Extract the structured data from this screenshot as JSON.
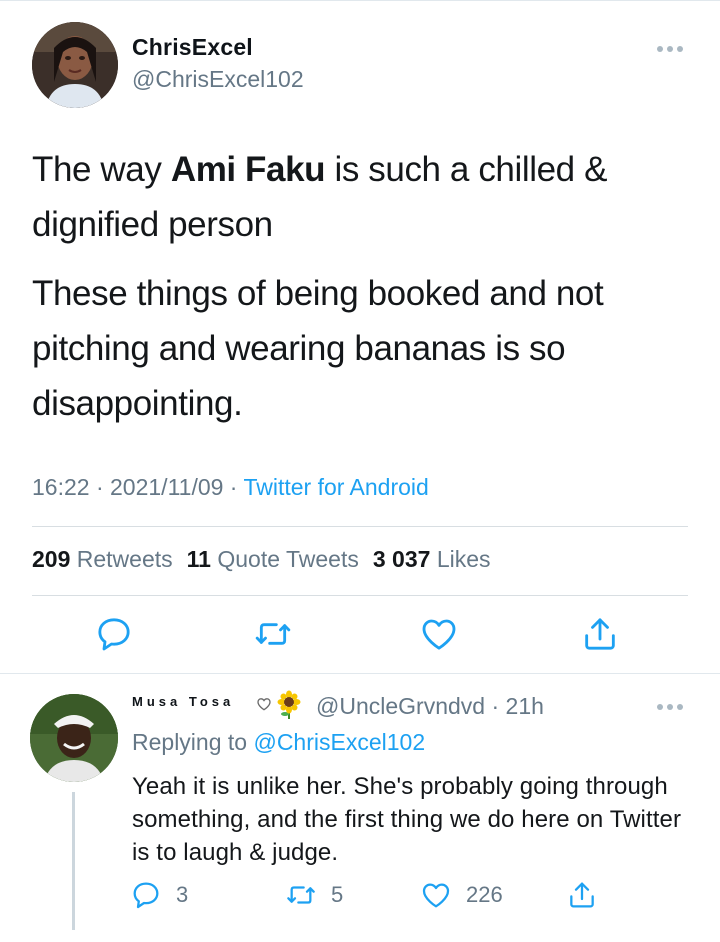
{
  "tweet": {
    "author": {
      "display_name": "ChrisExcel",
      "handle": "@ChrisExcel102",
      "avatar_icon": "avatar-photo"
    },
    "paragraph1": {
      "pre": "The way ",
      "bold": "Ami Faku",
      "post": " is such a chilled & dignified person"
    },
    "paragraph2": "These things of being booked and not pitching and wearing bananas is so disappointing.",
    "time": "16:22",
    "date": "2021/11/09",
    "source": "Twitter for Android",
    "separator": " · ",
    "stats": {
      "retweets_count": "209",
      "retweets_label": "Retweets",
      "quotes_count": "11",
      "quotes_label": "Quote Tweets",
      "likes_count": "3 037",
      "likes_label": "Likes"
    },
    "actions": [
      "reply-icon",
      "retweet-icon",
      "like-icon",
      "share-icon"
    ]
  },
  "reply": {
    "display_name": "Musa Tosa",
    "name_emojis": [
      "heart-outline-icon",
      "sunflower-icon"
    ],
    "handle": "@UncleGrvndvd",
    "time": "21h",
    "replying_prefix": "Replying to",
    "replying_to": "@ChrisExcel102",
    "text": "Yeah it is unlike her. She's probably going through something, and the first thing we do here on Twitter is to laugh & judge.",
    "counts": {
      "replies": "3",
      "retweets": "5",
      "likes": "226"
    }
  },
  "colors": {
    "accent": "#1da1f2",
    "secondary_text": "#657786",
    "divider": "#e1e8ed",
    "icon": "#1da1f2"
  }
}
